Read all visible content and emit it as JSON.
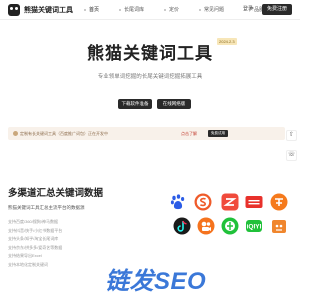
{
  "header": {
    "logo_text": "熊猫关键词工具",
    "nav": [
      "首页",
      "长尾词库",
      "定价",
      "常见问题",
      "产品服务"
    ],
    "login_label": "登录",
    "free_label": "免费注册"
  },
  "hero": {
    "title": "熊猫关键词工具",
    "badge": "2024.2.3",
    "subtitle": "专业领单词挖掘的长尾关键词挖掘拓展工具",
    "download_label": "下载软件准备",
    "online_label": "在线网络版"
  },
  "notice": {
    "text": "定制有长关键词工具（百度推广词包）正在开发中",
    "link": "点击了解",
    "button": "免费试用"
  },
  "section": {
    "title": "多渠道汇总关键词数据",
    "subtitle": "熊猫关键词工具汇总主流平台的数据源",
    "items": [
      "支持百度/360/搜狗/神马数据",
      "支持抖音/快手/小红书数据平台",
      "支持头条/知乎/淘宝长尾词库",
      "支持京东/拼多多/爱奇艺等数据",
      "支持结果导出Excel",
      "支持本地化定制关键词"
    ]
  },
  "platforms": [
    {
      "name": "baidu-icon",
      "color": "#2b5ce6"
    },
    {
      "name": "sogou-icon",
      "color": "#ef5b2a"
    },
    {
      "name": "shenma-icon",
      "color": "#f04a3b"
    },
    {
      "name": "toutiao-icon",
      "color": "#e8312b"
    },
    {
      "name": "taobao-icon",
      "color": "#f57a1c"
    },
    {
      "name": "douyin-icon",
      "color": "#1a1a1a"
    },
    {
      "name": "kuaishou-icon",
      "color": "#f5731e"
    },
    {
      "name": "iqiyi-icon",
      "color": "#20c13a"
    },
    {
      "name": "xiaohongshu-icon",
      "color": "#e8312b"
    },
    {
      "name": "ant-icon",
      "color": "#f0862d"
    }
  ],
  "watermark": "链发SEO",
  "colors": {
    "dark": "#2a2a2a",
    "notice_bg": "#f8f1ea",
    "accent": "#3b78d8"
  }
}
